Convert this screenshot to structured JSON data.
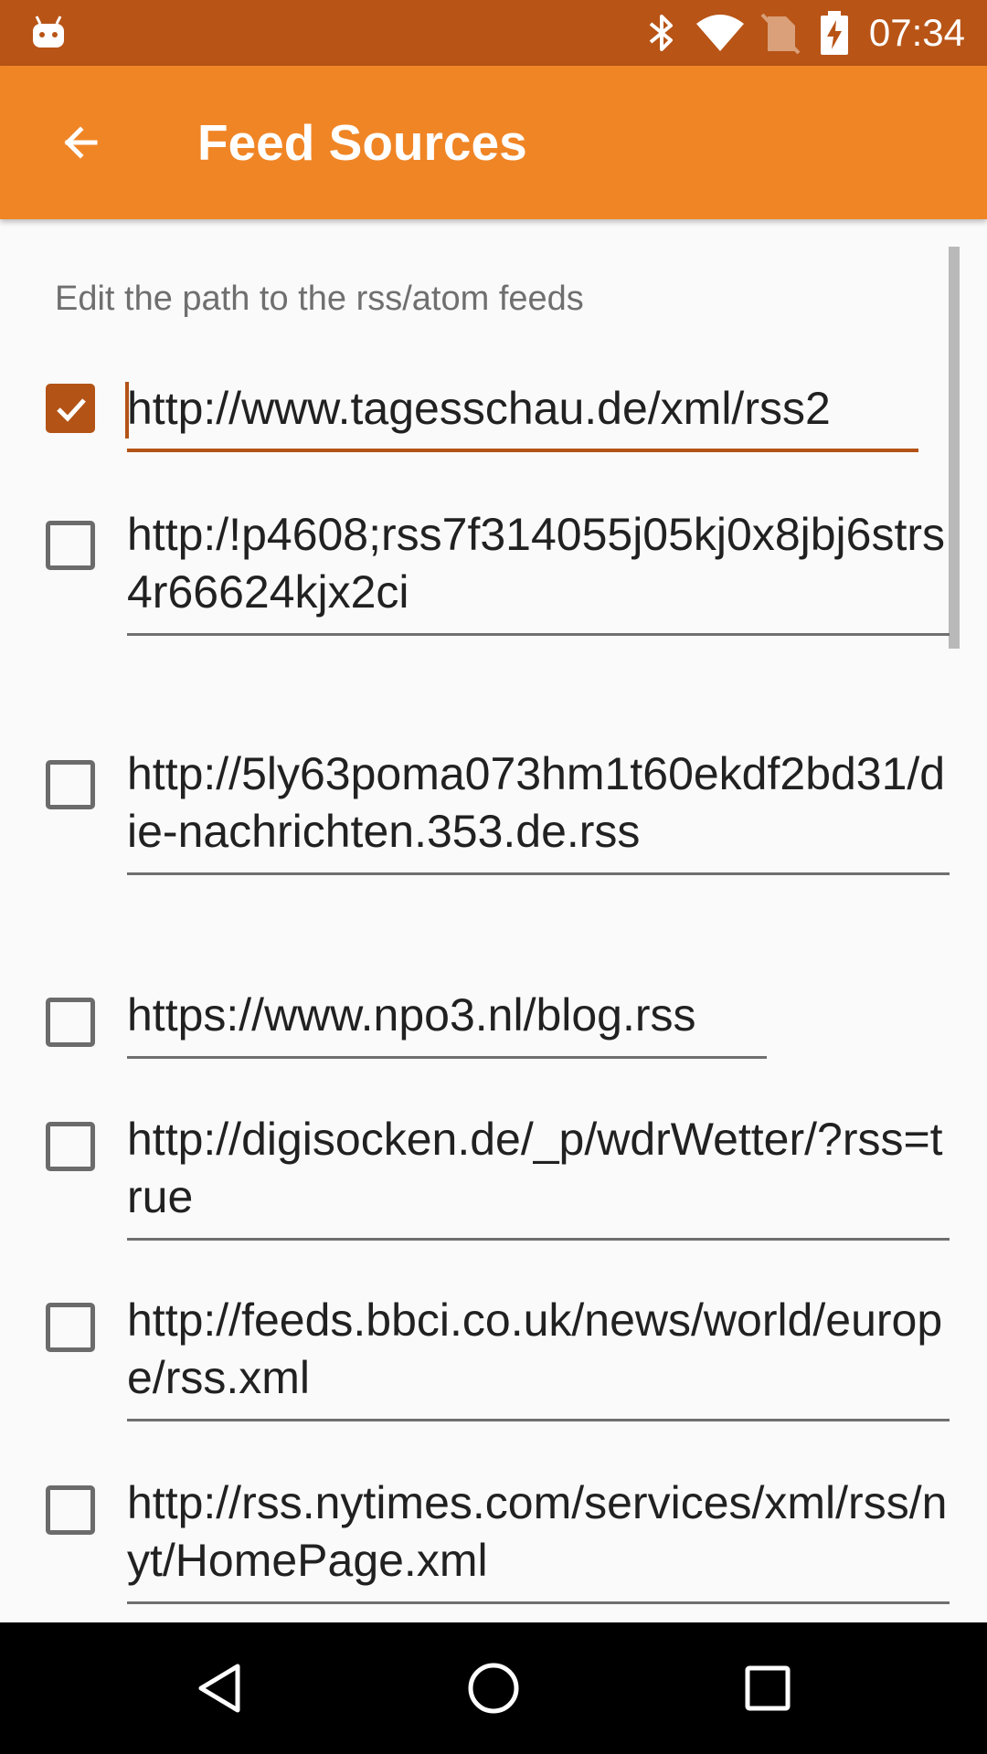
{
  "status_bar": {
    "time": "07:34",
    "icons": [
      "android-notification-icon",
      "bluetooth-icon",
      "wifi-icon",
      "no-sim-icon",
      "battery-charging-icon"
    ]
  },
  "app_bar": {
    "title": "Feed Sources",
    "back_icon": "arrow-back-icon"
  },
  "content": {
    "hint": "Edit the path to the rss/atom feeds",
    "feeds": [
      {
        "checked": true,
        "url": "http://www.tagesschau.de/xml/rss2"
      },
      {
        "checked": false,
        "url": "http:/!p4608;rss7f314055j05kj0x8jbj6strs4r66624kjx2ci"
      },
      {
        "checked": false,
        "url": "http://5ly63poma073hm1t60ekdf2bd31/die-nachrichten.353.de.rss"
      },
      {
        "checked": false,
        "url": "https://www.npo3.nl/blog.rss"
      },
      {
        "checked": false,
        "url": "http://digisocken.de/_p/wdrWetter/?rss=true"
      },
      {
        "checked": false,
        "url": "http://feeds.bbci.co.uk/news/world/europe/rss.xml"
      },
      {
        "checked": false,
        "url": "http://rss.nytimes.com/services/xml/rss/nyt/HomePage.xml"
      }
    ]
  },
  "nav_bar": {
    "icons": [
      "back-triangle-icon",
      "home-circle-icon",
      "recents-square-icon"
    ]
  },
  "colors": {
    "status_bar": "#b85416",
    "app_bar": "#f08526",
    "accent": "#b35316"
  }
}
